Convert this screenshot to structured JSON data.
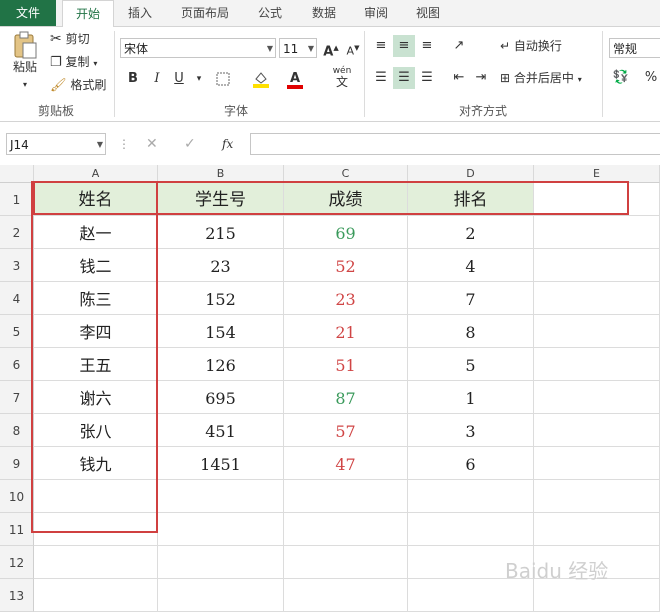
{
  "ribbon_tabs": [
    "文件",
    "开始",
    "插入",
    "页面布局",
    "公式",
    "数据",
    "审阅",
    "视图"
  ],
  "clipboard": {
    "paste": "粘贴",
    "cut": "剪切",
    "copy": "复制",
    "format_painter": "格式刷",
    "group_label": "剪贴板"
  },
  "font": {
    "name": "宋体",
    "size": "11",
    "bold": "B",
    "italic": "I",
    "underline": "U",
    "font_color": "A",
    "phonetic": "wén",
    "group_label": "字体"
  },
  "alignment": {
    "wrap_text": "自动换行",
    "merge_center": "合并后居中",
    "group_label": "对齐方式"
  },
  "number": {
    "format": "常规",
    "percent": "%"
  },
  "formula_bar": {
    "name_box": "J14",
    "fx": "fx",
    "formula": ""
  },
  "sheet": {
    "columns": [
      "A",
      "B",
      "C",
      "D",
      "E"
    ],
    "rows": [
      "1",
      "2",
      "3",
      "4",
      "5",
      "6",
      "7",
      "8",
      "9",
      "10",
      "11",
      "12",
      "13"
    ],
    "headers": [
      "姓名",
      "学生号",
      "成绩",
      "排名"
    ],
    "data": [
      {
        "name": "赵一",
        "id": "215",
        "score": "69",
        "rank": "2",
        "pass": true
      },
      {
        "name": "钱二",
        "id": "23",
        "score": "52",
        "rank": "4",
        "pass": false
      },
      {
        "name": "陈三",
        "id": "152",
        "score": "23",
        "rank": "7",
        "pass": false
      },
      {
        "name": "李四",
        "id": "154",
        "score": "21",
        "rank": "8",
        "pass": false
      },
      {
        "name": "王五",
        "id": "126",
        "score": "51",
        "rank": "5",
        "pass": false
      },
      {
        "name": "谢六",
        "id": "695",
        "score": "87",
        "rank": "1",
        "pass": true
      },
      {
        "name": "张八",
        "id": "451",
        "score": "57",
        "rank": "3",
        "pass": false
      },
      {
        "name": "钱九",
        "id": "1451",
        "score": "47",
        "rank": "6",
        "pass": false
      }
    ],
    "colors": {
      "pass": "#3a9a5b",
      "fail": "#d04545",
      "header_fill": "#e2efda",
      "highlight_border": "#d04040"
    }
  },
  "watermark": "Baidu 经验"
}
